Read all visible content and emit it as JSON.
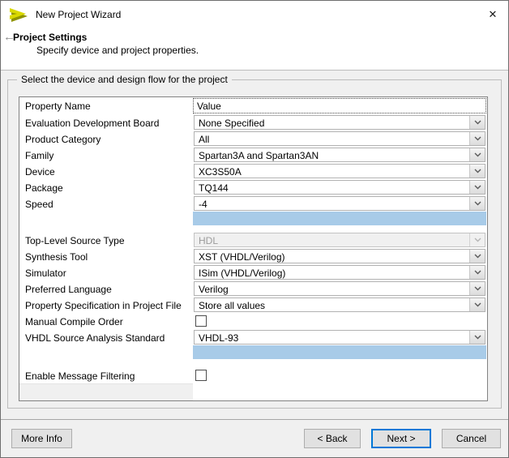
{
  "window": {
    "title": "New Project Wizard",
    "close_label": "✕"
  },
  "header": {
    "back_icon": "←",
    "title": "Project Settings",
    "subtitle": "Specify device and project properties."
  },
  "groupbox": {
    "label": "Select the device and design flow for the project"
  },
  "table": {
    "columns": {
      "name": "Property Name",
      "value": "Value"
    },
    "rows": [
      {
        "type": "combo",
        "name": "Evaluation Development Board",
        "value": "None Specified"
      },
      {
        "type": "combo",
        "name": "Product Category",
        "value": "All"
      },
      {
        "type": "combo",
        "name": "Family",
        "value": "Spartan3A and Spartan3AN"
      },
      {
        "type": "combo",
        "name": "Device",
        "value": "XC3S50A"
      },
      {
        "type": "combo",
        "name": "Package",
        "value": "TQ144"
      },
      {
        "type": "combo",
        "name": "Speed",
        "value": "-4"
      },
      {
        "type": "highlight"
      },
      {
        "type": "spacer"
      },
      {
        "type": "combo",
        "name": "Top-Level Source Type",
        "value": "HDL",
        "disabled": true
      },
      {
        "type": "combo",
        "name": "Synthesis Tool",
        "value": "XST (VHDL/Verilog)"
      },
      {
        "type": "combo",
        "name": "Simulator",
        "value": "ISim (VHDL/Verilog)"
      },
      {
        "type": "combo",
        "name": "Preferred Language",
        "value": "Verilog"
      },
      {
        "type": "combo",
        "name": "Property Specification in Project File",
        "value": "Store all values"
      },
      {
        "type": "checkbox",
        "name": "Manual Compile Order",
        "checked": false
      },
      {
        "type": "combo",
        "name": "VHDL Source Analysis Standard",
        "value": "VHDL-93"
      },
      {
        "type": "highlight"
      },
      {
        "type": "spacer2"
      },
      {
        "type": "checkbox",
        "name": "Enable Message Filtering",
        "checked": false
      },
      {
        "type": "filler"
      }
    ]
  },
  "buttons": {
    "more_info": "More Info",
    "back": "< Back",
    "next": "Next >",
    "cancel": "Cancel"
  },
  "colors": {
    "highlight_blue": "#a8cbe8",
    "focus_blue": "#0078d7"
  }
}
